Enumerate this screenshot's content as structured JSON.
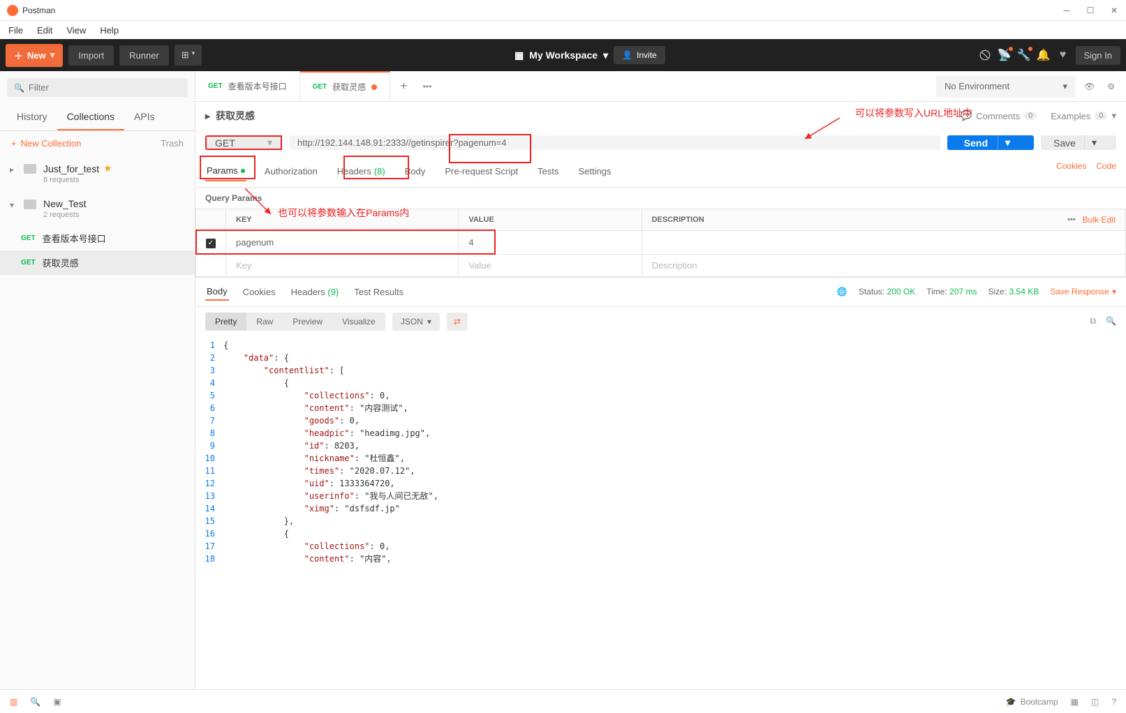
{
  "window": {
    "title": "Postman"
  },
  "menubar": [
    "File",
    "Edit",
    "View",
    "Help"
  ],
  "toolbar": {
    "new_label": "New",
    "import_label": "Import",
    "runner_label": "Runner",
    "workspace_label": "My Workspace",
    "invite_label": "Invite",
    "signin_label": "Sign In"
  },
  "sidebar": {
    "filter_placeholder": "Filter",
    "tabs": [
      "History",
      "Collections",
      "APIs"
    ],
    "active_tab": "Collections",
    "new_collection": "New Collection",
    "trash": "Trash",
    "collections": [
      {
        "name": "Just_for_test",
        "starred": true,
        "meta": "8 requests",
        "expanded": false
      },
      {
        "name": "New_Test",
        "starred": false,
        "meta": "2 requests",
        "expanded": true,
        "requests": [
          {
            "method": "GET",
            "name": "查看版本号接口",
            "active": false
          },
          {
            "method": "GET",
            "name": "获取灵感",
            "active": true
          }
        ]
      }
    ]
  },
  "tabs": [
    {
      "method": "GET",
      "name": "查看版本号接口",
      "unsaved": false,
      "active": false
    },
    {
      "method": "GET",
      "name": "获取灵感",
      "unsaved": true,
      "active": true
    }
  ],
  "env": {
    "label": "No Environment"
  },
  "request": {
    "name": "获取灵感",
    "comments_label": "Comments",
    "comments_count": "0",
    "examples_label": "Examples",
    "examples_count": "0",
    "method": "GET",
    "url": "http://192.144.148.91:2333//getinspirer?pagenum=4",
    "send": "Send",
    "save": "Save",
    "sub_tabs": {
      "params": "Params",
      "auth": "Authorization",
      "headers": "Headers",
      "headers_count": "(8)",
      "body": "Body",
      "prereq": "Pre-request Script",
      "tests": "Tests",
      "settings": "Settings",
      "cookies": "Cookies",
      "code": "Code"
    },
    "query_params_label": "Query Params",
    "table": {
      "headers": {
        "key": "KEY",
        "value": "VALUE",
        "desc": "DESCRIPTION",
        "bulk": "Bulk Edit"
      },
      "rows": [
        {
          "checked": true,
          "key": "pagenum",
          "value": "4",
          "desc": ""
        }
      ],
      "placeholder": {
        "key": "Key",
        "value": "Value",
        "desc": "Description"
      }
    }
  },
  "response": {
    "tabs": {
      "body": "Body",
      "cookies": "Cookies",
      "headers": "Headers",
      "headers_count": "(9)",
      "test_results": "Test Results"
    },
    "status_label": "Status:",
    "status": "200 OK",
    "time_label": "Time:",
    "time": "207 ms",
    "size_label": "Size:",
    "size": "3.54 KB",
    "save_response": "Save Response",
    "views": {
      "pretty": "Pretty",
      "raw": "Raw",
      "preview": "Preview",
      "visualize": "Visualize"
    },
    "format": "JSON",
    "code_lines": [
      "{",
      "    \"data\": {",
      "        \"contentlist\": [",
      "            {",
      "                \"collections\": 0,",
      "                \"content\": \"内容测试\",",
      "                \"goods\": 0,",
      "                \"headpic\": \"headimg.jpg\",",
      "                \"id\": 8203,",
      "                \"nickname\": \"杜恒鑫\",",
      "                \"times\": \"2020.07.12\",",
      "                \"uid\": 1333364720,",
      "                \"userinfo\": \"我与人间已无敌\",",
      "                \"ximg\": \"dsfsdf.jp\"",
      "            },",
      "            {",
      "                \"collections\": 0,",
      "                \"content\": \"内容\","
    ]
  },
  "annotations": {
    "url_note": "可以将参数写入URL地址中",
    "params_note": "也可以将参数输入在Params内"
  },
  "statusbar": {
    "bootcamp": "Bootcamp"
  }
}
